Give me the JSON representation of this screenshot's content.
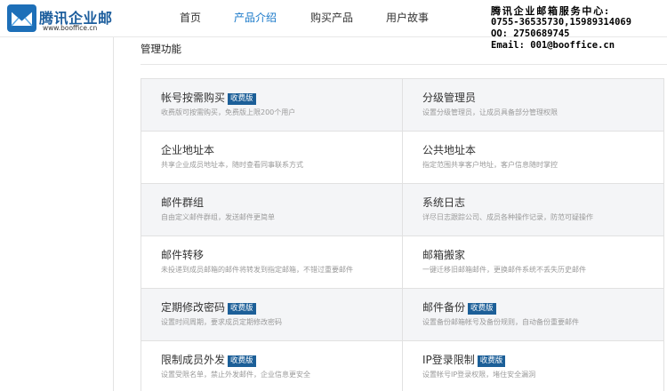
{
  "brand": {
    "title": "腾讯企业邮",
    "url": "www.booffice.cn",
    "color": "#1d5e9d"
  },
  "nav": [
    {
      "label": "首页",
      "active": false
    },
    {
      "label": "产品介绍",
      "active": true
    },
    {
      "label": "购买产品",
      "active": false
    },
    {
      "label": "用户故事",
      "active": false
    }
  ],
  "contact": {
    "title": "腾讯企业邮箱服务中心:",
    "phones": "0755-36535730,15989314069",
    "qq": "QQ:  2750689745",
    "email": "Email: 001@booffice.cn"
  },
  "section": {
    "title": "管理功能"
  },
  "features": [
    {
      "name": "帐号按需购买",
      "badge": "收费版",
      "desc": "收费版可按需购买，免费版上限200个用户"
    },
    {
      "name": "分级管理员",
      "badge": "",
      "desc": "设置分级管理员，让成员具备部分管理权限"
    },
    {
      "name": "企业地址本",
      "badge": "",
      "desc": "共享企业成员地址本，随时查看同事联系方式"
    },
    {
      "name": "公共地址本",
      "badge": "",
      "desc": "指定范围共享客户地址，客户信息随时掌控"
    },
    {
      "name": "邮件群组",
      "badge": "",
      "desc": "自由定义邮件群组，发送邮件更简单"
    },
    {
      "name": "系统日志",
      "badge": "",
      "desc": "详尽日志跟踪公司、成员各种操作记录，防范可疑操作"
    },
    {
      "name": "邮件转移",
      "badge": "",
      "desc": "未投递到成员邮箱的邮件将转发到指定邮箱，不错过重要邮件"
    },
    {
      "name": "邮箱搬家",
      "badge": "",
      "desc": "一键迁移旧邮箱邮件，更换邮件系统不丢失历史邮件"
    },
    {
      "name": "定期修改密码",
      "badge": "收费版",
      "desc": "设置时间周期，要求成员定期修改密码"
    },
    {
      "name": "邮件备份",
      "badge": "收费版",
      "desc": "设置备份邮箱帐号及备份规则，自动备份重要邮件"
    },
    {
      "name": "限制成员外发",
      "badge": "收费版",
      "desc": "设置受限名单，禁止外发邮件，企业信息更安全"
    },
    {
      "name": "IP登录限制",
      "badge": "收费版",
      "desc": "设置帐号IP登录权限，堵住安全漏洞"
    }
  ]
}
